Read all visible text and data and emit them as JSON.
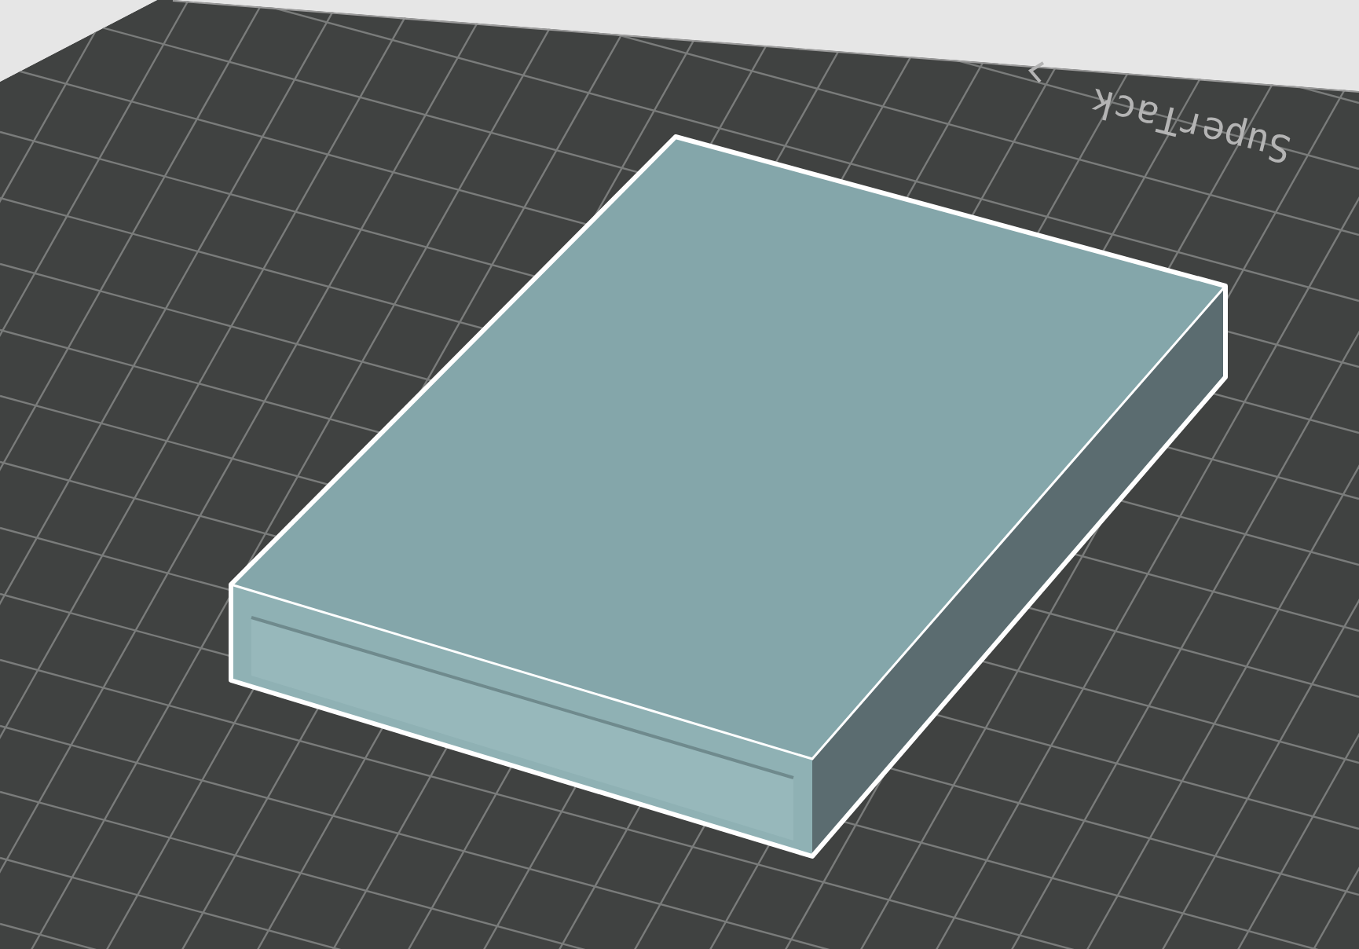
{
  "scene": {
    "bed_logo": "SuperTack"
  }
}
